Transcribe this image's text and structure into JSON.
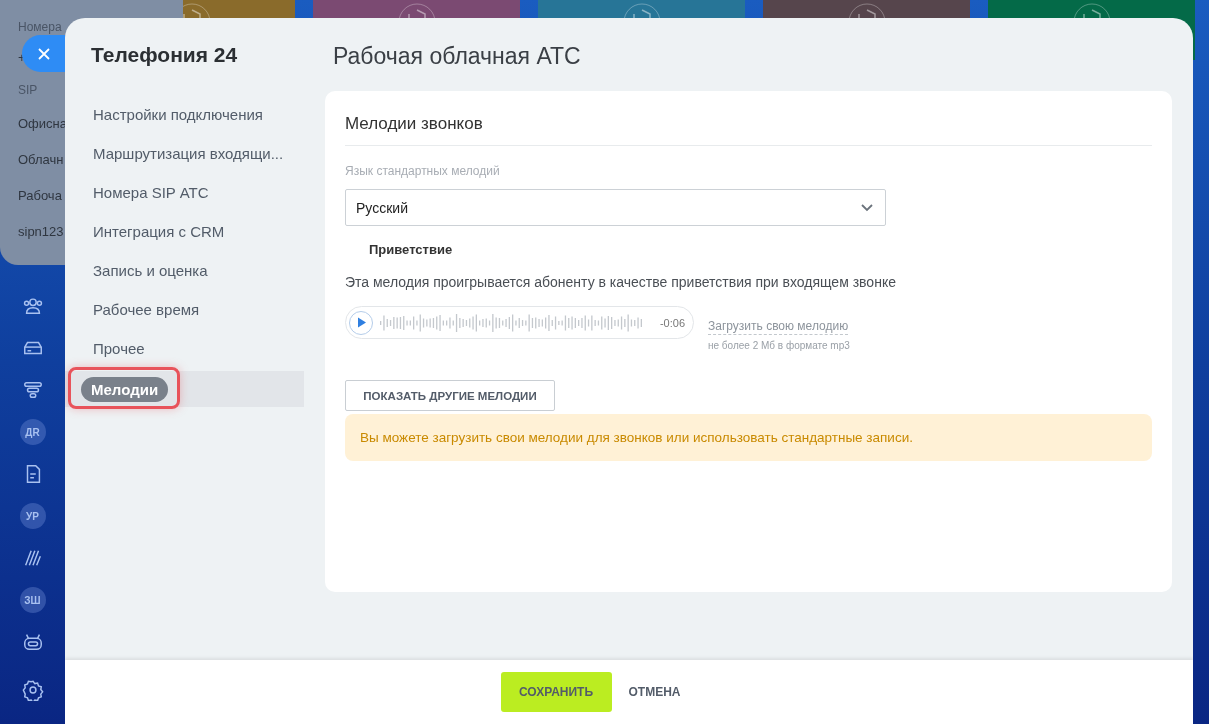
{
  "background_tiles": [
    {
      "color": "#8a6b2b"
    },
    {
      "color": "#7b4a72"
    },
    {
      "color": "#277597"
    },
    {
      "color": "#56454c"
    },
    {
      "color": "#046a48"
    }
  ],
  "left_bar": {
    "items": [
      {
        "kind": "icon"
      },
      {
        "kind": "icon"
      },
      {
        "kind": "icon"
      },
      {
        "kind": "avatar",
        "text": "ДR"
      },
      {
        "kind": "icon"
      },
      {
        "kind": "avatar",
        "text": "УР"
      },
      {
        "kind": "icon"
      },
      {
        "kind": "avatar",
        "text": "ЗШ"
      },
      {
        "kind": "icon"
      },
      {
        "kind": "icon"
      }
    ]
  },
  "popup": {
    "heading": "Номера",
    "phone": "+",
    "section": "SIP",
    "items": [
      "Офисна",
      "Облачн",
      "Рабоча",
      "sipn123"
    ]
  },
  "slider": {
    "app_title": "Телефония 24",
    "menu": [
      {
        "label": "Настройки подключения",
        "selected": false,
        "highlighted": false
      },
      {
        "label": "Маршрутизация входящи...",
        "selected": false,
        "highlighted": false
      },
      {
        "label": "Номера SIP АТС",
        "selected": false,
        "highlighted": false
      },
      {
        "label": "Интеграция с CRM",
        "selected": false,
        "highlighted": false
      },
      {
        "label": "Запись и оценка",
        "selected": false,
        "highlighted": false
      },
      {
        "label": "Рабочее время",
        "selected": false,
        "highlighted": false
      },
      {
        "label": "Прочее",
        "selected": false,
        "highlighted": false
      },
      {
        "label": "Мелодии",
        "selected": true,
        "highlighted": true
      }
    ],
    "page_title": "Рабочая облачная АТС",
    "card": {
      "title": "Мелодии звонков",
      "language_label": "Язык стандартных мелодий",
      "language_value": "Русский",
      "melody": {
        "name": "Приветствие",
        "description": "Эта мелодия проигрывается абоненту в качестве приветствия при входящем звонке",
        "time": "-0:06",
        "upload_link": "Загрузить свою мелодию",
        "upload_note": "не более 2 Мб в формате mp3"
      },
      "show_more_button": "ПОКАЗАТЬ ДРУГИЕ МЕЛОДИИ",
      "notice": "Вы можете загрузить свои мелодии для звонков или использовать стандартные записи."
    },
    "footer": {
      "save": "СОХРАНИТЬ",
      "cancel": "ОТМЕНА"
    }
  }
}
